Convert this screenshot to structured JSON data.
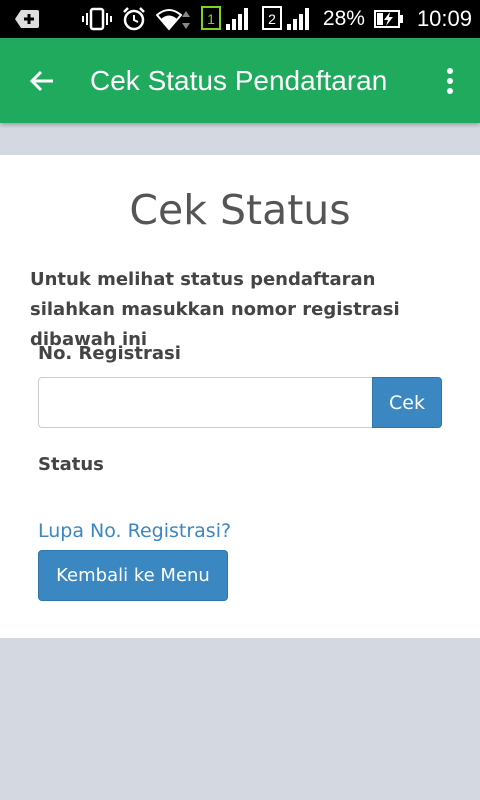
{
  "statusbar": {
    "battery_percent": "28%",
    "time": "10:09",
    "sim1_label": "1",
    "sim2_label": "2",
    "icons": [
      "add-notification-icon",
      "vibrate-icon",
      "alarm-icon",
      "wifi-icon",
      "sim1-signal-icon",
      "sim2-signal-icon",
      "battery-charging-icon"
    ]
  },
  "appbar": {
    "title": "Cek Status Pendaftaran",
    "back_icon": "arrow-left-icon",
    "overflow_icon": "more-vert-icon",
    "color": "#1faa5d"
  },
  "content": {
    "heading": "Cek Status",
    "intro": "Untuk melihat status pendaftaran silahkan masukkan nomor registrasi dibawah ini",
    "reg_label": "No. Registrasi",
    "reg_value": "",
    "reg_placeholder": "",
    "cek_button": "Cek",
    "status_label": "Status",
    "forgot_link": "Lupa No. Registrasi?",
    "menu_button": "Kembali ke Menu"
  },
  "colors": {
    "accent": "#3a87c2",
    "page_bg": "#d4d8e0"
  }
}
